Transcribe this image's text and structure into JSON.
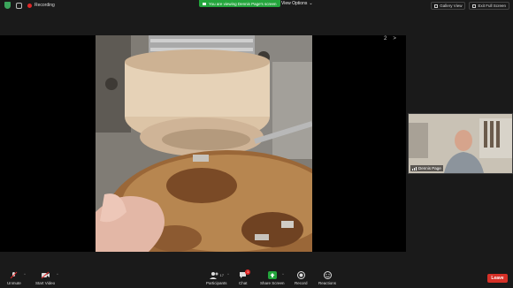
{
  "topbar": {
    "recording_label": "Recording",
    "viewing_banner": "You are viewing Dennis Page's screen",
    "view_options_label": "View Options",
    "view_options_caret": "⌄",
    "gallery_view_label": "Gallery View",
    "exit_fullscreen_label": "Exit Full Screen"
  },
  "share": {
    "page_indicator": "2",
    "next_arrow": ">"
  },
  "participant": {
    "name": "Dennis Page"
  },
  "toolbar": {
    "unmute_label": "Unmute",
    "start_video_label": "Start Video",
    "participants_label": "Participants",
    "participants_count": "17",
    "chat_label": "Chat",
    "chat_badge": "1",
    "share_screen_label": "Share Screen",
    "record_label": "Record",
    "reactions_label": "Reactions",
    "leave_label": "Leave",
    "caret": "^"
  },
  "colors": {
    "share_green": "#23a53c",
    "leave_red": "#d63027",
    "record_red": "#e02828",
    "background": "#1a1a1a"
  }
}
